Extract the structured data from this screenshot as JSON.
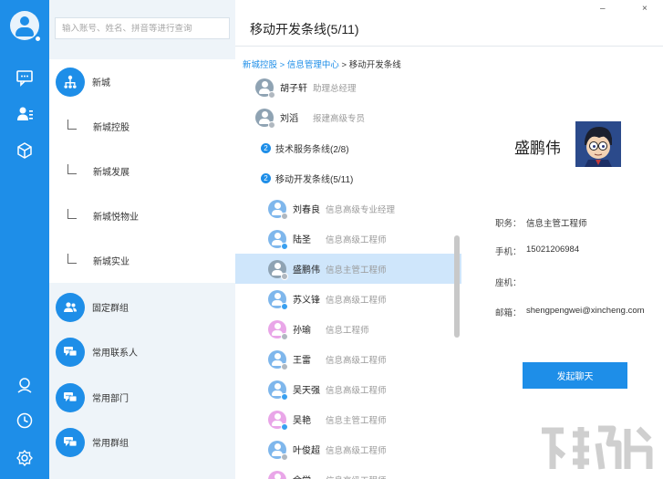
{
  "rail": {
    "icons": [
      "user-avatar",
      "chat-icon",
      "contacts-icon",
      "apps-cube-icon",
      "profile-icon",
      "clock-icon",
      "settings-icon"
    ]
  },
  "search": {
    "placeholder": "输入账号、姓名、拼音等进行查询"
  },
  "org": {
    "items": [
      {
        "label": "新城",
        "kind": "root"
      },
      {
        "label": "新城控股",
        "kind": "sub"
      },
      {
        "label": "新城发展",
        "kind": "sub"
      },
      {
        "label": "新城悦物业",
        "kind": "sub"
      },
      {
        "label": "新城实业",
        "kind": "sub"
      },
      {
        "label": "固定群组",
        "kind": "group"
      },
      {
        "label": "常用联系人",
        "kind": "contact"
      },
      {
        "label": "常用部门",
        "kind": "contact"
      },
      {
        "label": "常用群组",
        "kind": "contact"
      }
    ]
  },
  "main": {
    "title": "移动开发条线(5/11)",
    "window_controls": {
      "minimize": "–",
      "close": "×"
    },
    "breadcrumb": {
      "a": "新城控股",
      "b": "信息管理中心",
      "sep": " > ",
      "current": "移动开发条线"
    }
  },
  "members_top": [
    {
      "name": "胡子轩",
      "role": "助理总经理",
      "avatar": "grey"
    },
    {
      "name": "刘滔",
      "role": "报建高级专员",
      "avatar": "grey"
    }
  ],
  "groups": [
    {
      "badge": "2",
      "label": "技术服务条线(2/8)"
    },
    {
      "badge": "2",
      "label": "移动开发条线(5/11)"
    }
  ],
  "members": [
    {
      "name": "刘春良",
      "role": "信息高级专业经理",
      "avatar": "blue",
      "status": "grey"
    },
    {
      "name": "陆圣",
      "role": "信息高级工程师",
      "avatar": "blue",
      "status": "blue"
    },
    {
      "name": "盛鹏伟",
      "role": "信息主管工程师",
      "avatar": "grey",
      "status": "grey",
      "selected": true
    },
    {
      "name": "苏义锋",
      "role": "信息高级工程师",
      "avatar": "blue",
      "status": "blue"
    },
    {
      "name": "孙瑜",
      "role": "信息工程师",
      "avatar": "pink",
      "status": "grey"
    },
    {
      "name": "王雷",
      "role": "信息高级工程师",
      "avatar": "blue",
      "status": "grey"
    },
    {
      "name": "吴天强",
      "role": "信息高级工程师",
      "avatar": "blue",
      "status": "blue"
    },
    {
      "name": "吴艳",
      "role": "信息主管工程师",
      "avatar": "pink",
      "status": "blue"
    },
    {
      "name": "叶俊超",
      "role": "信息高级工程师",
      "avatar": "blue",
      "status": "grey"
    },
    {
      "name": "余学...",
      "role": "信息高级工程师",
      "avatar": "pink",
      "status": "grey"
    }
  ],
  "detail": {
    "name": "盛鹏伟",
    "fields": [
      {
        "key": "职务：",
        "value": "信息主管工程师"
      },
      {
        "key": "手机：",
        "value": "15021206984"
      },
      {
        "key": "座机：",
        "value": ""
      },
      {
        "key": "邮箱：",
        "value": "shengpengwei@xincheng.com"
      }
    ],
    "chat_button": "发起聊天"
  },
  "colors": {
    "accent": "#1e8ee8",
    "rail": "#1e8ee8",
    "selected": "#cfe6fb",
    "panel": "#eef4f9"
  }
}
